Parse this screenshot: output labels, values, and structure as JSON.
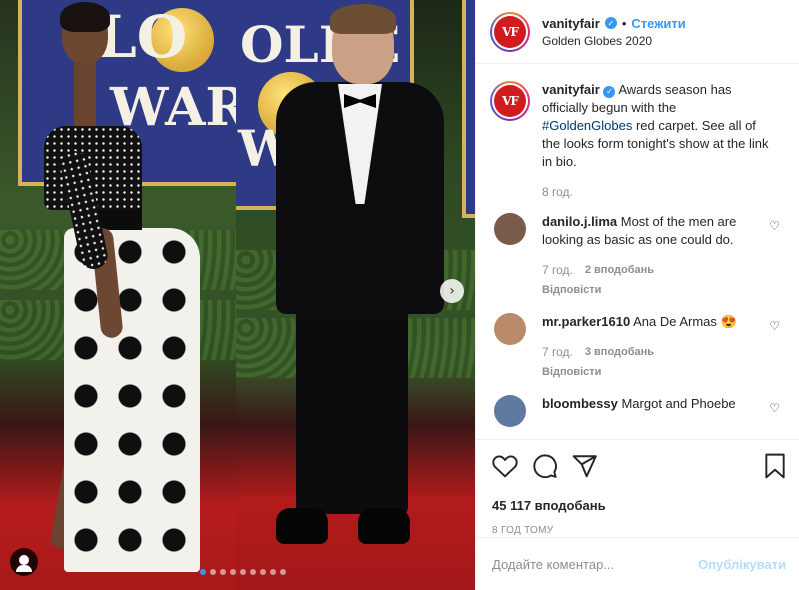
{
  "post": {
    "user": {
      "username": "vanityfair",
      "avatar_text": "VF",
      "follow_separator": "•",
      "follow_label": "Стежити",
      "location": "Golden Globes 2020"
    },
    "caption": {
      "username": "vanityfair",
      "text_before": " Awards season has officially begun with the ",
      "hashtag": "#GoldenGlobes",
      "text_after": " red carpet. See all of the looks form tonight's show at the link in bio.",
      "time": "8 год."
    },
    "comments": [
      {
        "username": "danilo.j.lima",
        "text": " Most of the men are looking as basic as one could do.",
        "time": "7 год.",
        "likes": "2 вподобань",
        "reply": "Відповісти",
        "avatar_color": "#7a5a48"
      },
      {
        "username": "mr.parker1610",
        "text": " Ana De Armas 😍",
        "time": "7 год.",
        "likes": "3 вподобань",
        "reply": "Відповісти",
        "avatar_color": "#b98b6b"
      },
      {
        "username": "bloombessy",
        "text": " Margot and Phoebe",
        "avatar_color": "#5f7aa0"
      }
    ],
    "likes_count": "45 117 вподобань",
    "posted_ago": "8 ГОД ТОМУ",
    "comment_placeholder": "Додайте коментар...",
    "publish_label": "Опублікувати",
    "icons": {
      "like": "heart-icon",
      "comment": "comment-icon",
      "share": "share-icon",
      "save": "bookmark-icon",
      "next": "chevron-right-icon",
      "tag": "user-tag-icon"
    },
    "carousel": {
      "total": 9,
      "active_index": 0
    },
    "photo_backdrop": {
      "left_letters": [
        "LO",
        "WAR"
      ],
      "right_letters": [
        "OLDE",
        "WA"
      ]
    }
  },
  "colors": {
    "accent": "#3897f0",
    "hashtag": "#00376b",
    "muted": "#8e8e8e",
    "publish_disabled": "#b2dffc",
    "brand_red": "#d01c1f"
  }
}
